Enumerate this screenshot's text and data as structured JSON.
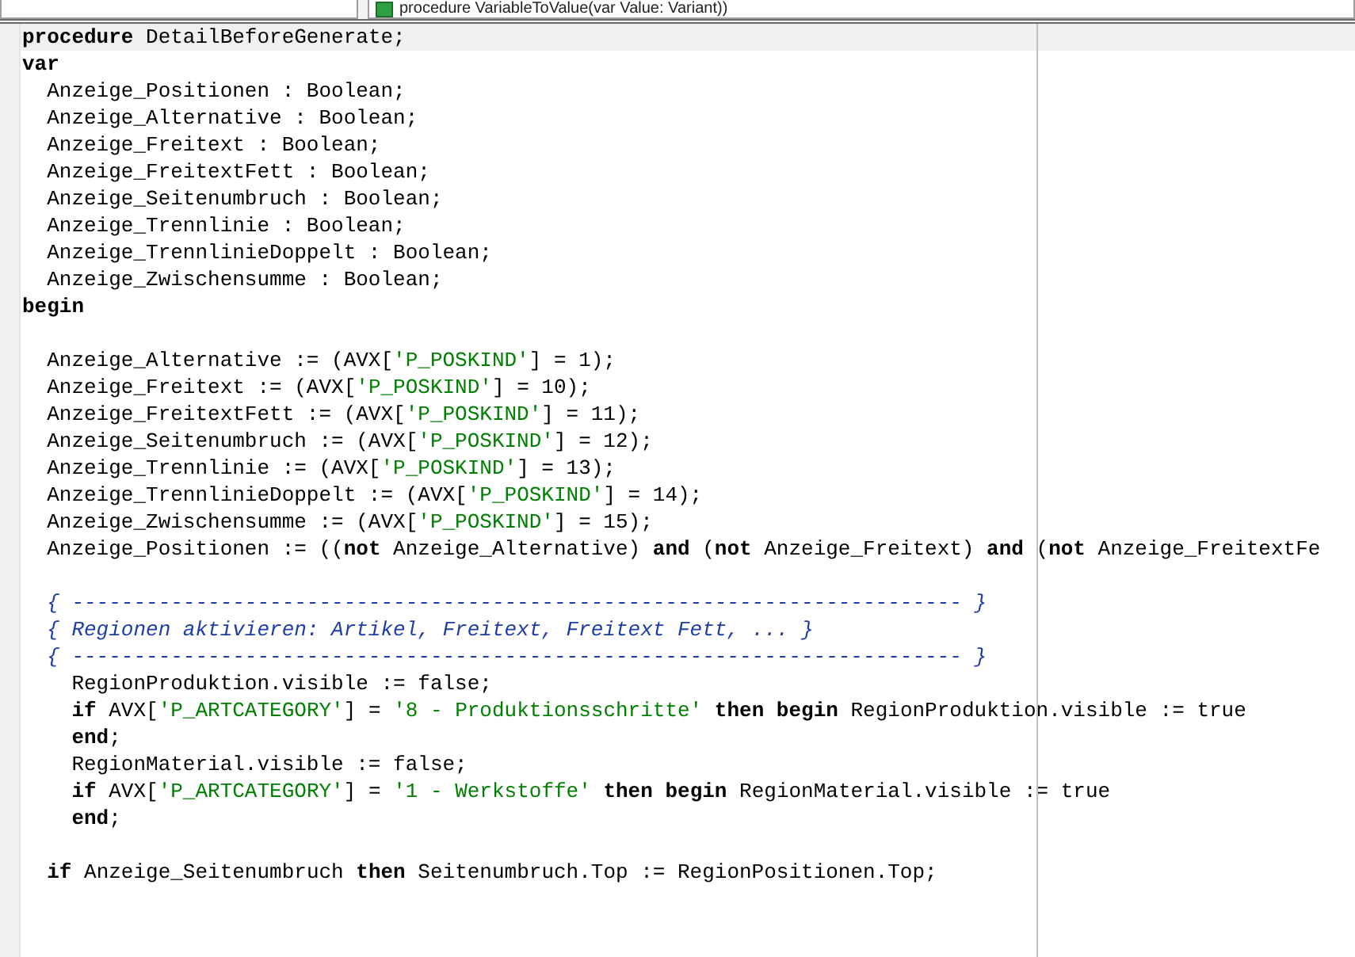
{
  "tabs": [
    {
      "label": "procedure VariableToValue(var Value: Variant))",
      "selected": false
    }
  ],
  "editor": {
    "lines": [
      {
        "kind": "code",
        "current": true,
        "tokens": [
          {
            "t": "procedure",
            "kind": "keyword"
          },
          {
            "t": " DetailBeforeGenerate;",
            "kind": "plain"
          }
        ]
      },
      {
        "kind": "code",
        "current": false,
        "tokens": [
          {
            "t": "var",
            "kind": "keyword"
          }
        ]
      },
      {
        "kind": "code",
        "current": false,
        "tokens": [
          {
            "t": "  Anzeige_Positionen : Boolean;",
            "kind": "plain"
          }
        ]
      },
      {
        "kind": "code",
        "current": false,
        "tokens": [
          {
            "t": "  Anzeige_Alternative : Boolean;",
            "kind": "plain"
          }
        ]
      },
      {
        "kind": "code",
        "current": false,
        "tokens": [
          {
            "t": "  Anzeige_Freitext : Boolean;",
            "kind": "plain"
          }
        ]
      },
      {
        "kind": "code",
        "current": false,
        "tokens": [
          {
            "t": "  Anzeige_FreitextFett : Boolean;",
            "kind": "plain"
          }
        ]
      },
      {
        "kind": "code",
        "current": false,
        "tokens": [
          {
            "t": "  Anzeige_Seitenumbruch : Boolean;",
            "kind": "plain"
          }
        ]
      },
      {
        "kind": "code",
        "current": false,
        "tokens": [
          {
            "t": "  Anzeige_Trennlinie : Boolean;",
            "kind": "plain"
          }
        ]
      },
      {
        "kind": "code",
        "current": false,
        "tokens": [
          {
            "t": "  Anzeige_TrennlinieDoppelt : Boolean;",
            "kind": "plain"
          }
        ]
      },
      {
        "kind": "code",
        "current": false,
        "tokens": [
          {
            "t": "  Anzeige_Zwischensumme : Boolean;",
            "kind": "plain"
          }
        ]
      },
      {
        "kind": "code",
        "current": false,
        "tokens": [
          {
            "t": "begin",
            "kind": "keyword"
          }
        ]
      },
      {
        "kind": "blank"
      },
      {
        "kind": "code",
        "current": false,
        "tokens": [
          {
            "t": "  Anzeige_Alternative := (AVX[",
            "kind": "plain"
          },
          {
            "t": "'P_POSKIND'",
            "kind": "string"
          },
          {
            "t": "] = 1);",
            "kind": "plain"
          }
        ]
      },
      {
        "kind": "code",
        "current": false,
        "tokens": [
          {
            "t": "  Anzeige_Freitext := (AVX[",
            "kind": "plain"
          },
          {
            "t": "'P_POSKIND'",
            "kind": "string"
          },
          {
            "t": "] = 10);",
            "kind": "plain"
          }
        ]
      },
      {
        "kind": "code",
        "current": false,
        "tokens": [
          {
            "t": "  Anzeige_FreitextFett := (AVX[",
            "kind": "plain"
          },
          {
            "t": "'P_POSKIND'",
            "kind": "string"
          },
          {
            "t": "] = 11);",
            "kind": "plain"
          }
        ]
      },
      {
        "kind": "code",
        "current": false,
        "tokens": [
          {
            "t": "  Anzeige_Seitenumbruch := (AVX[",
            "kind": "plain"
          },
          {
            "t": "'P_POSKIND'",
            "kind": "string"
          },
          {
            "t": "] = 12);",
            "kind": "plain"
          }
        ]
      },
      {
        "kind": "code",
        "current": false,
        "tokens": [
          {
            "t": "  Anzeige_Trennlinie := (AVX[",
            "kind": "plain"
          },
          {
            "t": "'P_POSKIND'",
            "kind": "string"
          },
          {
            "t": "] = 13);",
            "kind": "plain"
          }
        ]
      },
      {
        "kind": "code",
        "current": false,
        "tokens": [
          {
            "t": "  Anzeige_TrennlinieDoppelt := (AVX[",
            "kind": "plain"
          },
          {
            "t": "'P_POSKIND'",
            "kind": "string"
          },
          {
            "t": "] = 14);",
            "kind": "plain"
          }
        ]
      },
      {
        "kind": "code",
        "current": false,
        "tokens": [
          {
            "t": "  Anzeige_Zwischensumme := (AVX[",
            "kind": "plain"
          },
          {
            "t": "'P_POSKIND'",
            "kind": "string"
          },
          {
            "t": "] = 15);",
            "kind": "plain"
          }
        ]
      },
      {
        "kind": "code",
        "current": false,
        "tokens": [
          {
            "t": "  Anzeige_Positionen := ((",
            "kind": "plain"
          },
          {
            "t": "not",
            "kind": "keyword"
          },
          {
            "t": " Anzeige_Alternative) ",
            "kind": "plain"
          },
          {
            "t": "and",
            "kind": "keyword"
          },
          {
            "t": " (",
            "kind": "plain"
          },
          {
            "t": "not",
            "kind": "keyword"
          },
          {
            "t": " Anzeige_Freitext) ",
            "kind": "plain"
          },
          {
            "t": "and",
            "kind": "keyword"
          },
          {
            "t": " (",
            "kind": "plain"
          },
          {
            "t": "not",
            "kind": "keyword"
          },
          {
            "t": " Anzeige_FreitextFe",
            "kind": "plain"
          }
        ]
      },
      {
        "kind": "blank"
      },
      {
        "kind": "code",
        "current": false,
        "tokens": [
          {
            "t": "  { ------------------------------------------------------------------------ }",
            "kind": "comment"
          }
        ]
      },
      {
        "kind": "code",
        "current": false,
        "tokens": [
          {
            "t": "  { Regionen aktivieren: Artikel, Freitext, Freitext Fett, ... }",
            "kind": "comment"
          }
        ]
      },
      {
        "kind": "code",
        "current": false,
        "tokens": [
          {
            "t": "  { ------------------------------------------------------------------------ }",
            "kind": "comment"
          }
        ]
      },
      {
        "kind": "code",
        "current": false,
        "tokens": [
          {
            "t": "    RegionProduktion.visible := false;",
            "kind": "plain"
          }
        ]
      },
      {
        "kind": "code",
        "current": false,
        "tokens": [
          {
            "t": "    if",
            "kind": "keyword"
          },
          {
            "t": " AVX[",
            "kind": "plain"
          },
          {
            "t": "'P_ARTCATEGORY'",
            "kind": "string"
          },
          {
            "t": "] = ",
            "kind": "plain"
          },
          {
            "t": "'8 - Produktionsschritte'",
            "kind": "string"
          },
          {
            "t": " then begin",
            "kind": "keyword"
          },
          {
            "t": " RegionProduktion.visible := true",
            "kind": "plain"
          }
        ]
      },
      {
        "kind": "code",
        "current": false,
        "tokens": [
          {
            "t": "    end",
            "kind": "keyword"
          },
          {
            "t": ";",
            "kind": "plain"
          }
        ]
      },
      {
        "kind": "code",
        "current": false,
        "tokens": [
          {
            "t": "    RegionMaterial.visible := false;",
            "kind": "plain"
          }
        ]
      },
      {
        "kind": "code",
        "current": false,
        "tokens": [
          {
            "t": "    if",
            "kind": "keyword"
          },
          {
            "t": " AVX[",
            "kind": "plain"
          },
          {
            "t": "'P_ARTCATEGORY'",
            "kind": "string"
          },
          {
            "t": "] = ",
            "kind": "plain"
          },
          {
            "t": "'1 - Werkstoffe'",
            "kind": "string"
          },
          {
            "t": " then begin",
            "kind": "keyword"
          },
          {
            "t": " RegionMaterial.visible := true",
            "kind": "plain"
          }
        ]
      },
      {
        "kind": "code",
        "current": false,
        "tokens": [
          {
            "t": "    end",
            "kind": "keyword"
          },
          {
            "t": ";",
            "kind": "plain"
          }
        ]
      },
      {
        "kind": "blank"
      },
      {
        "kind": "code",
        "current": false,
        "tokens": [
          {
            "t": "  if",
            "kind": "keyword"
          },
          {
            "t": " Anzeige_Seitenumbruch ",
            "kind": "plain"
          },
          {
            "t": "then",
            "kind": "keyword"
          },
          {
            "t": " Seitenumbruch.Top := RegionPositionen.Top;",
            "kind": "plain"
          }
        ]
      }
    ]
  }
}
